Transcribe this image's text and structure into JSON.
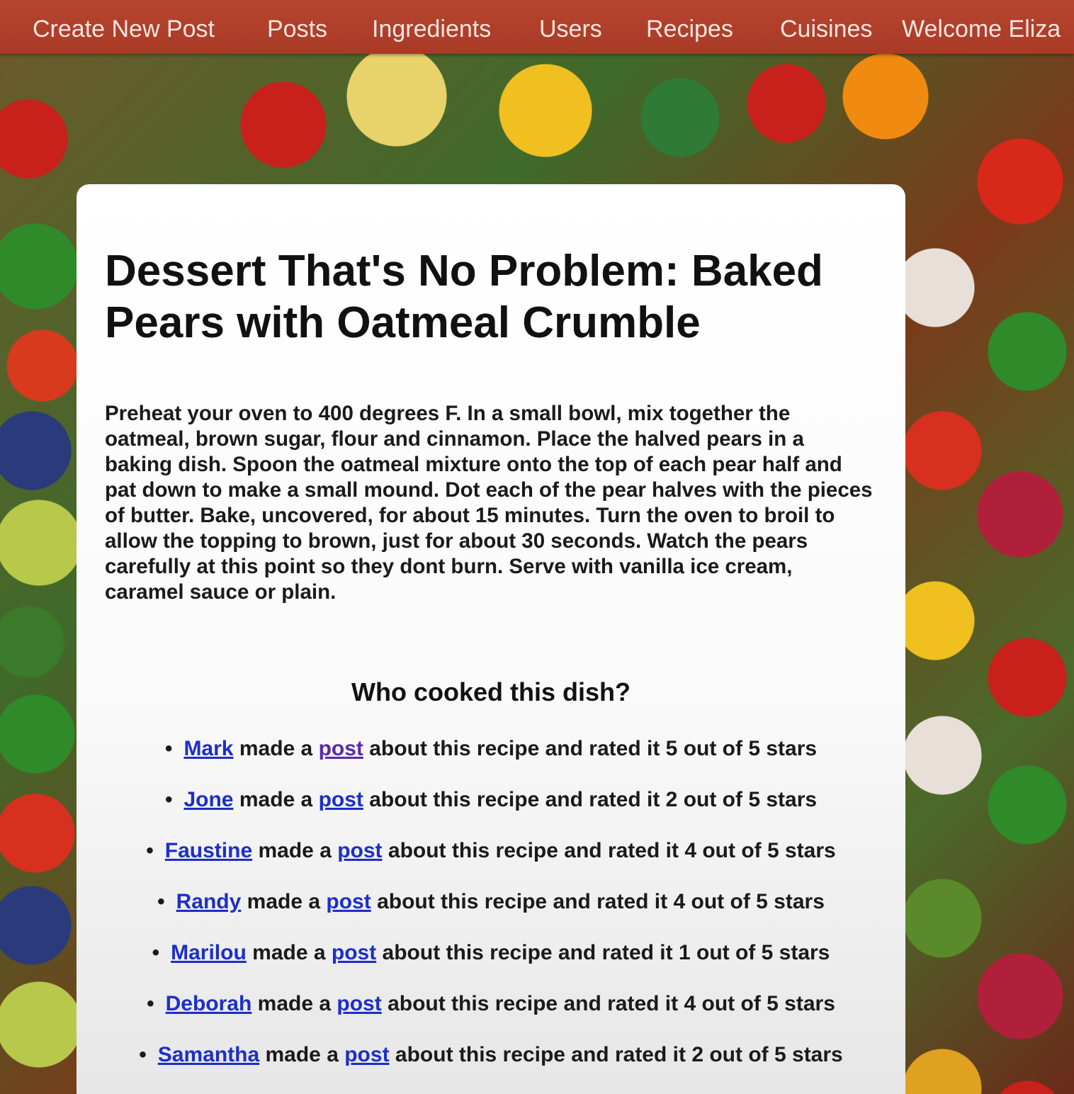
{
  "nav": {
    "items": [
      {
        "label": "Create New Post"
      },
      {
        "label": "Posts"
      },
      {
        "label": "Ingredients"
      },
      {
        "label": "Users"
      },
      {
        "label": "Recipes"
      },
      {
        "label": "Cuisines"
      },
      {
        "label": "Welcome Eliza"
      }
    ]
  },
  "recipe": {
    "title": "Dessert That's No Problem: Baked Pears with Oatmeal Crumble",
    "instructions": "Preheat your oven to 400 degrees F. In a small bowl, mix together the oatmeal, brown sugar, flour and cinnamon. Place the halved pears in a baking dish. Spoon the oatmeal mixture onto the top of each pear half and pat down to make a small mound. Dot each of the pear halves with the pieces of butter. Bake, uncovered, for about 15 minutes. Turn the oven to broil to allow the topping to brown, just for about 30 seconds. Watch the pears carefully at this point so they dont burn. Serve with vanilla ice cream, caramel sauce or plain."
  },
  "cooks": {
    "heading": "Who cooked this dish?",
    "bullet": "•",
    "made_text": "made a",
    "post_link_label": "post",
    "rated_prefix": "about this recipe and rated it",
    "rated_suffix": "out of 5 stars",
    "entries": [
      {
        "name": "Mark",
        "rating": 5
      },
      {
        "name": "Jone",
        "rating": 2
      },
      {
        "name": "Faustine",
        "rating": 4
      },
      {
        "name": "Randy",
        "rating": 4
      },
      {
        "name": "Marilou",
        "rating": 1
      },
      {
        "name": "Deborah",
        "rating": 4
      },
      {
        "name": "Samantha",
        "rating": 2
      }
    ]
  },
  "colors": {
    "nav_bar": "#b0402a",
    "link": "#1c2fc8",
    "visited_link": "#5a2aa8"
  }
}
